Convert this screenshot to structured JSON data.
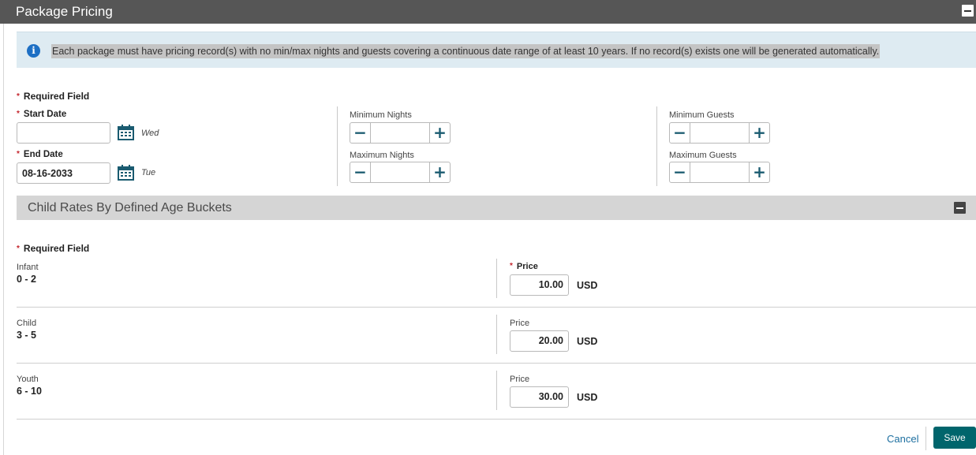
{
  "header": {
    "title": "Package Pricing"
  },
  "info": {
    "message": "Each package must have pricing record(s) with no min/max nights and guests covering a continuous date range of at least 10 years. If no record(s) exists one will be generated automatically."
  },
  "required_field_label": "Required Field",
  "dates": {
    "start_label": "Start Date",
    "start_value": "",
    "start_day": "Wed",
    "end_label": "End Date",
    "end_value": "08-16-2033",
    "end_day": "Tue"
  },
  "nights": {
    "min_label": "Minimum Nights",
    "max_label": "Maximum Nights"
  },
  "guests": {
    "min_label": "Minimum Guests",
    "max_label": "Maximum Guests"
  },
  "stepper_symbols": {
    "minus": "−",
    "plus": "+"
  },
  "child_rates": {
    "title": "Child Rates By Defined Age Buckets",
    "required_label": "Required Field",
    "buckets": [
      {
        "name": "Infant",
        "range": "0 - 2",
        "price_label": "Price",
        "price_required": true,
        "price": "10.00",
        "currency": "USD"
      },
      {
        "name": "Child",
        "range": "3 - 5",
        "price_label": "Price",
        "price_required": false,
        "price": "20.00",
        "currency": "USD"
      },
      {
        "name": "Youth",
        "range": "6 - 10",
        "price_label": "Price",
        "price_required": false,
        "price": "30.00",
        "currency": "USD"
      }
    ]
  },
  "footer": {
    "cancel_label": "Cancel",
    "save_label": "Save"
  },
  "colors": {
    "title_bar": "#565656",
    "info_bg": "#deebf2",
    "required": "#c4262e",
    "stepper_icon": "#1a5b70",
    "save_bg": "#00656c",
    "link": "#1d6fa0"
  }
}
